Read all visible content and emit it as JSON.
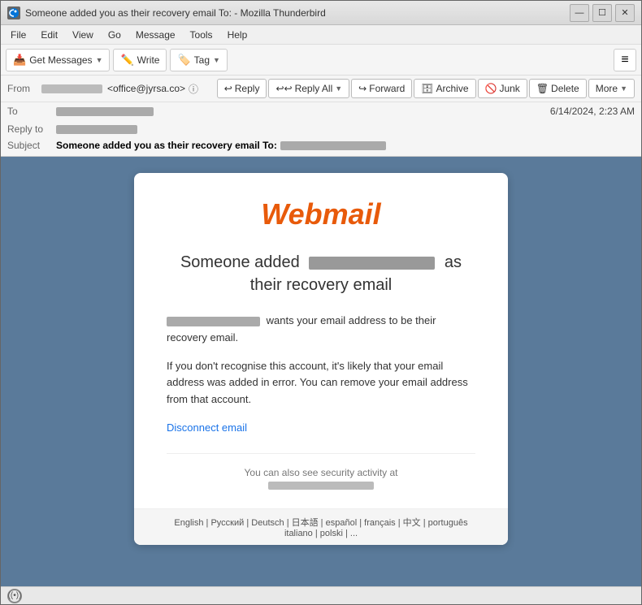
{
  "window": {
    "title": "Someone added you as their recovery email To: - Mozilla Thunderbird",
    "icon": "thunderbird"
  },
  "titlebar": {
    "title": "Someone added you as their recovery email To:        - Mozilla Thunderbird",
    "minimize_label": "—",
    "maximize_label": "☐",
    "close_label": "✕"
  },
  "menubar": {
    "items": [
      "File",
      "Edit",
      "View",
      "Go",
      "Message",
      "Tools",
      "Help"
    ]
  },
  "toolbar": {
    "get_messages_label": "Get Messages",
    "write_label": "Write",
    "tag_label": "Tag",
    "menu_icon": "≡"
  },
  "action_bar": {
    "reply_label": "Reply",
    "reply_all_label": "Reply All",
    "forward_label": "Forward",
    "archive_label": "Archive",
    "junk_label": "Junk",
    "delete_label": "Delete",
    "more_label": "More"
  },
  "email_header": {
    "from_label": "From",
    "from_value": "<office@jyrsa.co>",
    "to_label": "To",
    "reply_to_label": "Reply to",
    "subject_label": "Subject",
    "subject_prefix": "Someone added you as their recovery email To:",
    "date": "6/14/2024, 2:23 AM",
    "blurred_to_width": "120",
    "blurred_reply_width": "100",
    "blurred_sender_width": "80",
    "blurred_subject_width": "130"
  },
  "email_card": {
    "logo_text": "Webmail",
    "title_prefix": "Someone added",
    "title_suffix": "as",
    "title_line2": "their recovery email",
    "body_line1_suffix": "wants your email address to be their recovery email.",
    "body_line2": "If you don't recognise this account, it's likely that your email address was added in error. You can remove your email address from that account.",
    "disconnect_link": "Disconnect email",
    "security_text": "You can also see security activity at"
  },
  "lang_bar": {
    "languages": [
      "English",
      "Русский",
      "Deutsch",
      "日本語",
      "español",
      "français",
      "中文",
      "português",
      "italiano",
      "polski",
      "..."
    ]
  },
  "statusbar": {
    "icon": "((•))",
    "text": ""
  }
}
